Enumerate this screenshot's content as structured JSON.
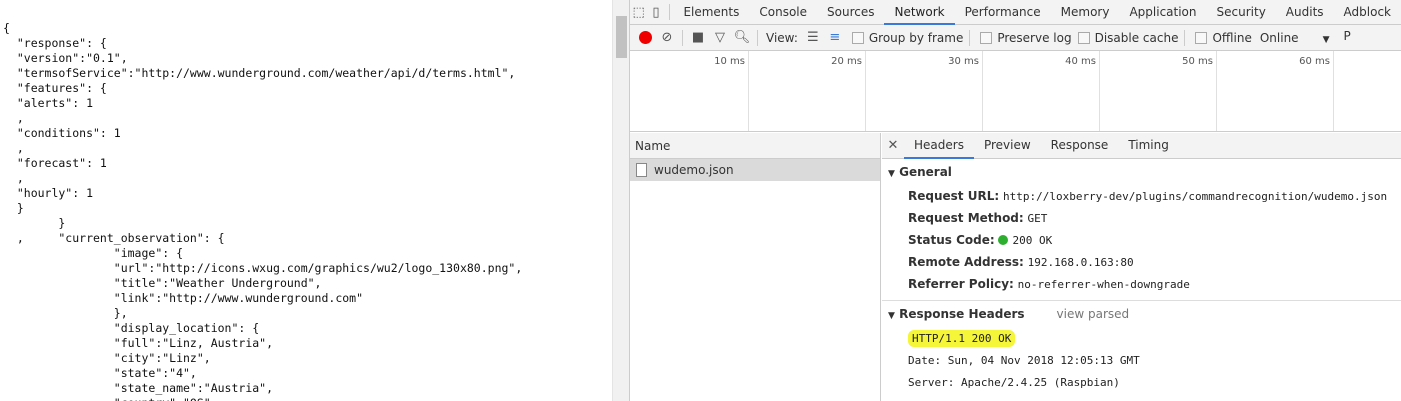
{
  "json_text": "{\n  \"response\": {\n  \"version\":\"0.1\",\n  \"termsofService\":\"http://www.wunderground.com/weather/api/d/terms.html\",\n  \"features\": {\n  \"alerts\": 1\n  ,\n  \"conditions\": 1\n  ,\n  \"forecast\": 1\n  ,\n  \"hourly\": 1\n  }\n        }\n  ,     \"current_observation\": {\n                \"image\": {\n                \"url\":\"http://icons.wxug.com/graphics/wu2/logo_130x80.png\",\n                \"title\":\"Weather Underground\",\n                \"link\":\"http://www.wunderground.com\"\n                },\n                \"display_location\": {\n                \"full\":\"Linz, Austria\",\n                \"city\":\"Linz\",\n                \"state\":\"4\",\n                \"state_name\":\"Austria\",\n                \"country\":\"OS\",",
  "tabs": [
    "Elements",
    "Console",
    "Sources",
    "Network",
    "Performance",
    "Memory",
    "Application",
    "Security",
    "Audits",
    "Adblock P"
  ],
  "active_tab": "Network",
  "toolbar": {
    "view_label": "View:",
    "group_by_frame": "Group by frame",
    "preserve_log": "Preserve log",
    "disable_cache": "Disable cache",
    "offline": "Offline",
    "throttle": "Online"
  },
  "timeline_ticks": [
    "10 ms",
    "20 ms",
    "30 ms",
    "40 ms",
    "50 ms",
    "60 ms"
  ],
  "name_header": "Name",
  "requests": [
    "wudemo.json"
  ],
  "detail_tabs": [
    "Headers",
    "Preview",
    "Response",
    "Timing"
  ],
  "general": {
    "title": "General",
    "rows": [
      {
        "k": "Request URL:",
        "v": "http://loxberry-dev/plugins/commandrecognition/wudemo.json"
      },
      {
        "k": "Request Method:",
        "v": "GET"
      },
      {
        "k": "Status Code:",
        "v": "200 OK"
      },
      {
        "k": "Remote Address:",
        "v": "192.168.0.163:80"
      },
      {
        "k": "Referrer Policy:",
        "v": "no-referrer-when-downgrade"
      }
    ]
  },
  "response_headers": {
    "title": "Response Headers",
    "view_parsed": "view parsed",
    "lines": [
      "HTTP/1.1 200 OK",
      "Date: Sun, 04 Nov 2018 12:05:13 GMT",
      "Server: Apache/2.4.25 (Raspbian)"
    ]
  },
  "colors": {
    "accent": "#3879d9",
    "record": "#ee0000",
    "status_ok": "#2eae2e",
    "highlight": "#f5f53a"
  }
}
